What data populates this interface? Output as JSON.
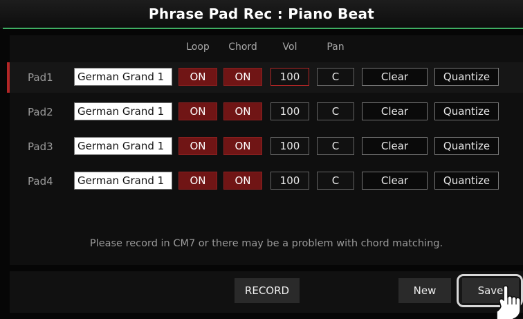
{
  "window": {
    "title": "Phrase Pad Rec : Piano Beat"
  },
  "columns": {
    "loop": "Loop",
    "chord": "Chord",
    "vol": "Vol",
    "pan": "Pan"
  },
  "pads": [
    {
      "label": "Pad1",
      "voice": "German Grand 1",
      "loop": "ON",
      "chord": "ON",
      "vol": "100",
      "pan": "C",
      "clear": "Clear",
      "quantize": "Quantize"
    },
    {
      "label": "Pad2",
      "voice": "German Grand 1",
      "loop": "ON",
      "chord": "ON",
      "vol": "100",
      "pan": "C",
      "clear": "Clear",
      "quantize": "Quantize"
    },
    {
      "label": "Pad3",
      "voice": "German Grand 1",
      "loop": "ON",
      "chord": "ON",
      "vol": "100",
      "pan": "C",
      "clear": "Clear",
      "quantize": "Quantize"
    },
    {
      "label": "Pad4",
      "voice": "German Grand 1",
      "loop": "ON",
      "chord": "ON",
      "vol": "100",
      "pan": "C",
      "clear": "Clear",
      "quantize": "Quantize"
    }
  ],
  "message": "Please record in CM7 or there may be a problem with chord matching.",
  "footer": {
    "record": "RECORD",
    "new": "New",
    "save": "Save"
  },
  "colors": {
    "accent_green": "#3fae63",
    "on_red": "#701515",
    "selection_red": "#b32626"
  },
  "icons": {
    "pointer": "pointing-hand-icon"
  }
}
